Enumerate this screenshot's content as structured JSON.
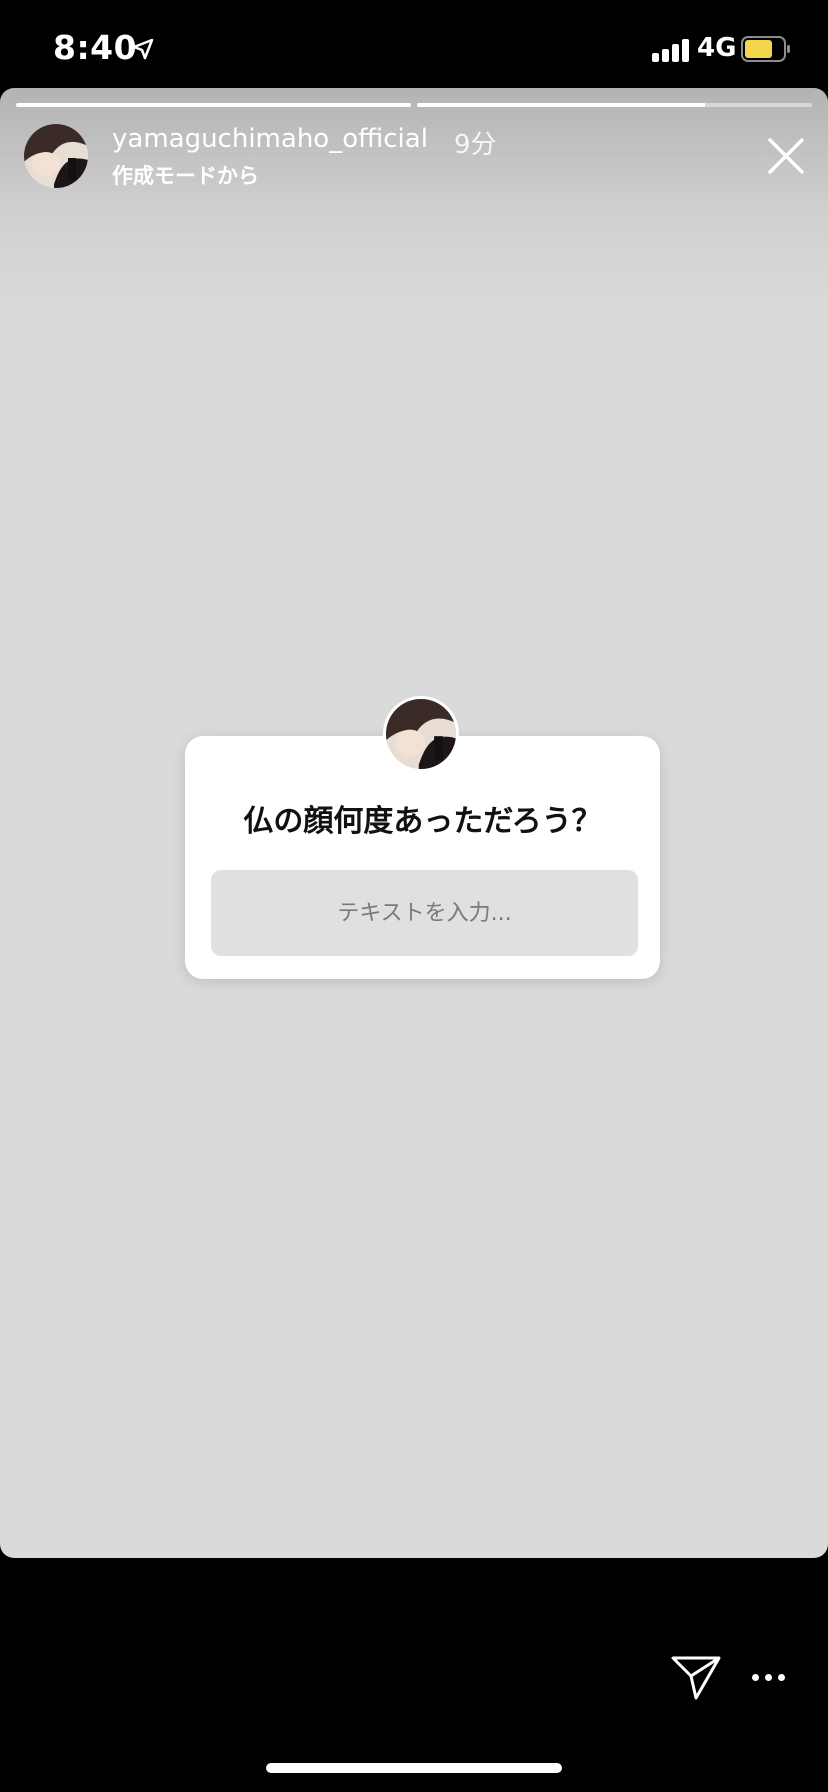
{
  "status_bar": {
    "time": "8:40",
    "network": "4G",
    "battery_color": "#f2d64b"
  },
  "story": {
    "progress": [
      1.0,
      0.73
    ],
    "username": "yamaguchimaho_official",
    "time_ago": "9分",
    "subtitle": "作成モードから",
    "icons": {
      "close": "close-icon",
      "location": "location-arrow-icon",
      "send": "send-icon",
      "more": "more-icon"
    }
  },
  "question_sticker": {
    "question": "仏の顔何度あっただろう？",
    "input_placeholder": "テキストを入力..."
  }
}
